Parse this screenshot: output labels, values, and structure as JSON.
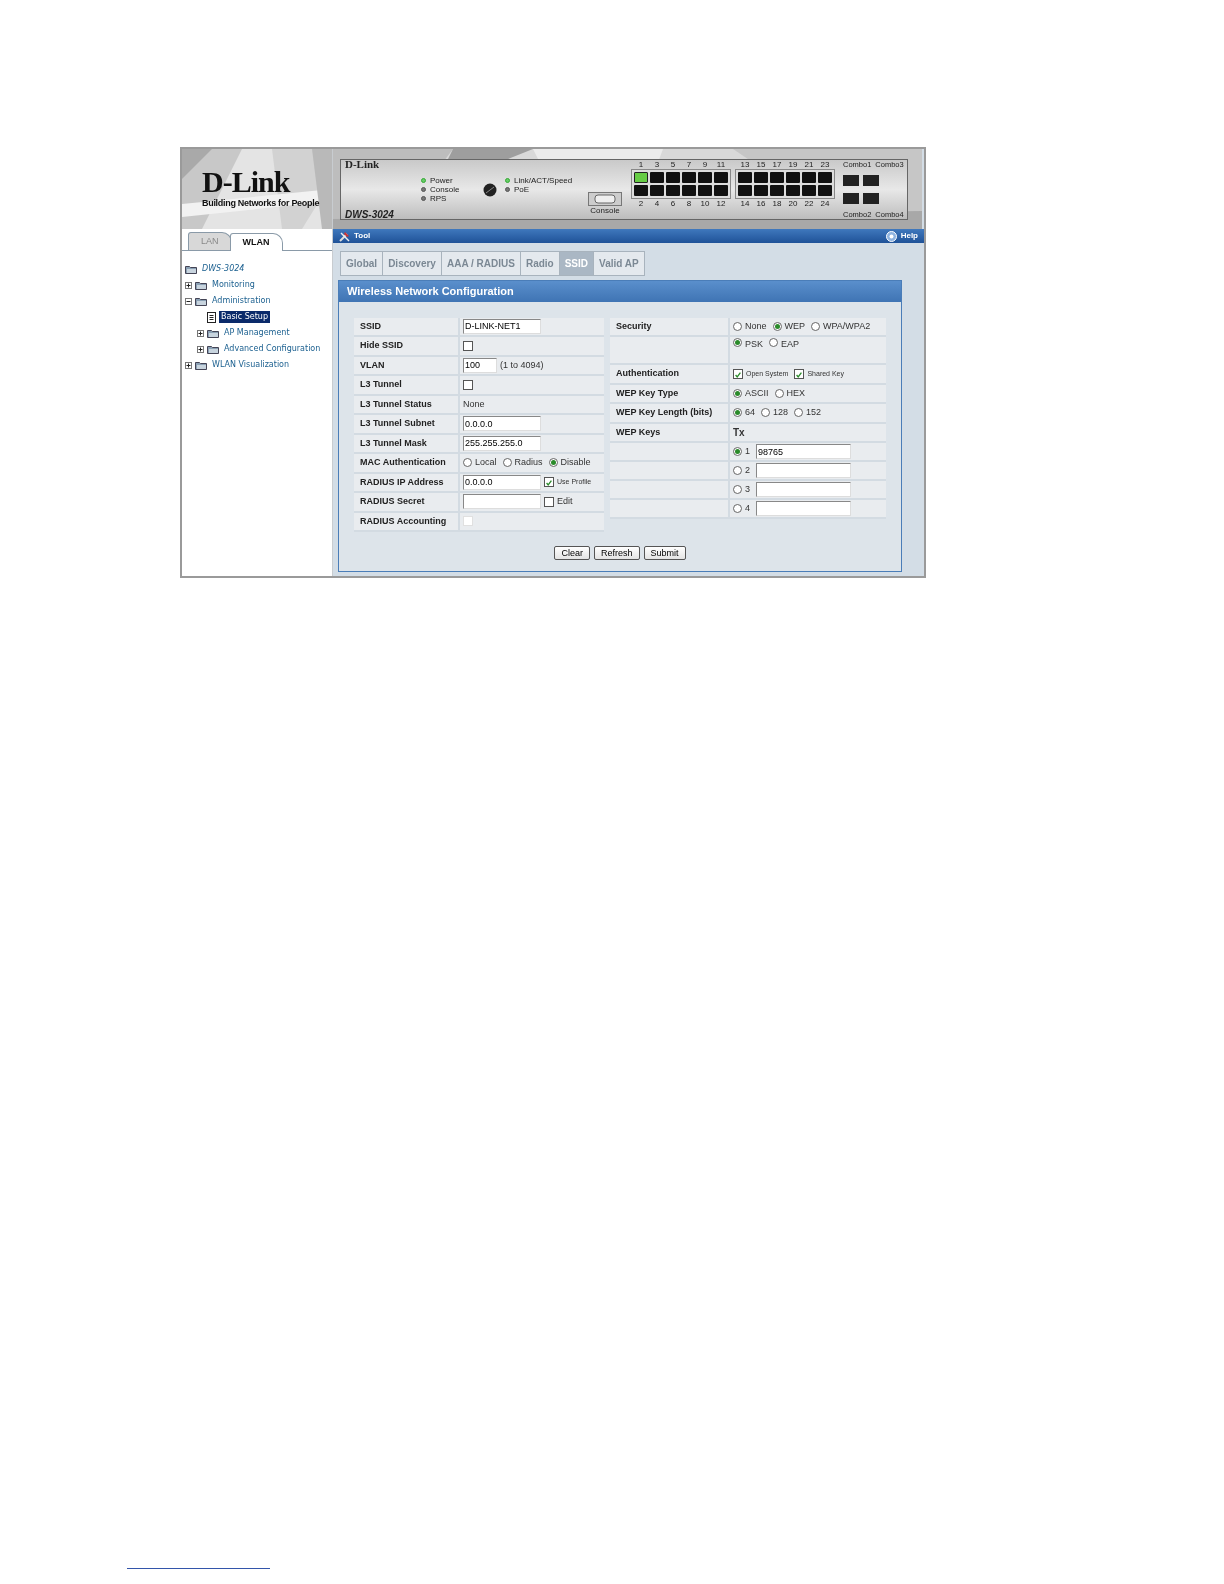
{
  "logo": {
    "brand": "D-Link",
    "tagline": "Building Networks for People"
  },
  "sidebar": {
    "tabs": [
      {
        "label": "LAN",
        "selected": false
      },
      {
        "label": "WLAN",
        "selected": true
      }
    ],
    "tree": {
      "label": "DWS-3024",
      "kind": "device",
      "selected": false,
      "children": [
        {
          "label": "Monitoring",
          "kind": "folder",
          "expanded": false,
          "selected": false
        },
        {
          "label": "Administration",
          "kind": "folder",
          "expanded": true,
          "selected": false,
          "children": [
            {
              "label": "Basic Setup",
              "kind": "page",
              "selected": true
            },
            {
              "label": "AP Management",
              "kind": "folder",
              "expanded": false,
              "selected": false
            },
            {
              "label": "Advanced Configuration",
              "kind": "folder",
              "expanded": false,
              "selected": false
            }
          ]
        },
        {
          "label": "WLAN Visualization",
          "kind": "folder",
          "expanded": false,
          "selected": false
        }
      ]
    }
  },
  "device": {
    "brand": "D-Link",
    "model": "DWS-3024",
    "status_leds": [
      {
        "label": "Power",
        "on": true
      },
      {
        "label": "Console",
        "on": false
      },
      {
        "label": "RPS",
        "on": false
      }
    ],
    "port_leds": [
      {
        "label": "Link/ACT/Speed",
        "on": true
      },
      {
        "label": "PoE",
        "on": false
      }
    ],
    "console_label": "Console",
    "ports": [
      {
        "label": "1",
        "link": true
      },
      {
        "label": "2",
        "link": false
      },
      {
        "label": "3",
        "link": false
      },
      {
        "label": "4",
        "link": false
      },
      {
        "label": "5",
        "link": false
      },
      {
        "label": "6",
        "link": false
      },
      {
        "label": "7",
        "link": false
      },
      {
        "label": "8",
        "link": false
      },
      {
        "label": "9",
        "link": false
      },
      {
        "label": "10",
        "link": false
      },
      {
        "label": "11",
        "link": false
      },
      {
        "label": "12",
        "link": false
      },
      {
        "label": "13",
        "link": false
      },
      {
        "label": "14",
        "link": false
      },
      {
        "label": "15",
        "link": false
      },
      {
        "label": "16",
        "link": false
      },
      {
        "label": "17",
        "link": false
      },
      {
        "label": "18",
        "link": false
      },
      {
        "label": "19",
        "link": false
      },
      {
        "label": "20",
        "link": false
      },
      {
        "label": "21",
        "link": false
      },
      {
        "label": "22",
        "link": false
      },
      {
        "label": "23",
        "link": false
      },
      {
        "label": "24",
        "link": false
      }
    ],
    "combos": [
      "Combo1",
      "Combo3",
      "Combo2",
      "Combo4"
    ]
  },
  "toolbar": {
    "tool": "Tool",
    "help": "Help"
  },
  "tabs": [
    {
      "label": "Global",
      "selected": false
    },
    {
      "label": "Discovery",
      "selected": false
    },
    {
      "label": "AAA / RADIUS",
      "selected": false
    },
    {
      "label": "Radio",
      "selected": false
    },
    {
      "label": "SSID",
      "selected": true
    },
    {
      "label": "Valid AP",
      "selected": false
    }
  ],
  "panel": {
    "title": "Wireless Network Configuration",
    "left_rows": [
      {
        "label": "SSID",
        "controls": [
          {
            "kind": "input",
            "value": "D-LINK-NET1"
          }
        ]
      },
      {
        "label": "Hide SSID",
        "controls": [
          {
            "kind": "checkbox",
            "checked": false,
            "disabled": false
          }
        ]
      },
      {
        "label": "VLAN",
        "controls": [
          {
            "kind": "short-input",
            "value": "100"
          },
          {
            "kind": "text",
            "text": "(1 to 4094)"
          }
        ]
      },
      {
        "label": "L3 Tunnel",
        "controls": [
          {
            "kind": "checkbox",
            "checked": false,
            "disabled": false
          }
        ]
      },
      {
        "label": "L3 Tunnel Status",
        "controls": [
          {
            "kind": "text",
            "text": "None"
          }
        ]
      },
      {
        "label": "L3 Tunnel Subnet",
        "controls": [
          {
            "kind": "input",
            "value": "0.0.0.0"
          }
        ]
      },
      {
        "label": "L3 Tunnel Mask",
        "controls": [
          {
            "kind": "input",
            "value": "255.255.255.0"
          }
        ]
      },
      {
        "label": "MAC Authentication",
        "controls": [
          {
            "kind": "radio",
            "label": "Local",
            "selected": false
          },
          {
            "kind": "radio",
            "label": "Radius",
            "selected": false
          },
          {
            "kind": "radio",
            "label": "Disable",
            "selected": true
          }
        ]
      },
      {
        "label": "RADIUS IP Address",
        "controls": [
          {
            "kind": "input",
            "value": "0.0.0.0"
          },
          {
            "kind": "checkbox",
            "label": "Use Profile",
            "checked": true,
            "disabled": false
          }
        ]
      },
      {
        "label": "RADIUS Secret",
        "controls": [
          {
            "kind": "input"
          },
          {
            "kind": "checkbox",
            "label": "Edit",
            "checked": false,
            "disabled": false
          }
        ]
      },
      {
        "label": "RADIUS Accounting",
        "controls": [
          {
            "kind": "checkbox",
            "checked": false,
            "disabled": true
          }
        ]
      }
    ],
    "right_rows": [
      {
        "label": "Security",
        "controls": [
          {
            "kind": "radio",
            "label": "None",
            "selected": false
          },
          {
            "kind": "radio",
            "label": "WEP",
            "selected": true
          },
          {
            "kind": "radio",
            "label": "WPA/WPA2",
            "selected": false
          }
        ]
      },
      {
        "controls": [
          {
            "kind": "radio",
            "label": "PSK",
            "selected": true
          },
          {
            "kind": "radio",
            "label": "EAP",
            "selected": false
          }
        ]
      },
      {
        "label": "Authentication",
        "controls": [
          {
            "kind": "checkbox",
            "label": "Open System",
            "checked": true,
            "disabled": false
          },
          {
            "kind": "checkbox",
            "label": "Shared Key",
            "checked": true,
            "disabled": false
          }
        ]
      },
      {
        "label": "WEP Key Type",
        "controls": [
          {
            "kind": "radio",
            "label": "ASCII",
            "selected": true
          },
          {
            "kind": "radio",
            "label": "HEX",
            "selected": false
          }
        ]
      },
      {
        "label": "WEP Key Length (bits)",
        "controls": [
          {
            "kind": "radio",
            "label": "64",
            "selected": true
          },
          {
            "kind": "radio",
            "label": "128",
            "selected": false
          },
          {
            "kind": "radio",
            "label": "152",
            "selected": false
          }
        ]
      },
      {
        "label": "WEP Keys",
        "controls": [
          {
            "kind": "bold-text",
            "text": "Tx"
          }
        ]
      },
      {
        "controls": [
          {
            "kind": "radio",
            "label": "1",
            "selected": true
          },
          {
            "kind": "input",
            "value": "98765"
          }
        ]
      },
      {
        "controls": [
          {
            "kind": "radio",
            "label": "2",
            "selected": false
          },
          {
            "kind": "input"
          }
        ]
      },
      {
        "controls": [
          {
            "kind": "radio",
            "label": "3",
            "selected": false
          },
          {
            "kind": "input"
          }
        ]
      },
      {
        "controls": [
          {
            "kind": "radio",
            "label": "4",
            "selected": false
          },
          {
            "kind": "input"
          }
        ]
      }
    ],
    "buttons": [
      "Clear",
      "Refresh",
      "Submit"
    ]
  }
}
